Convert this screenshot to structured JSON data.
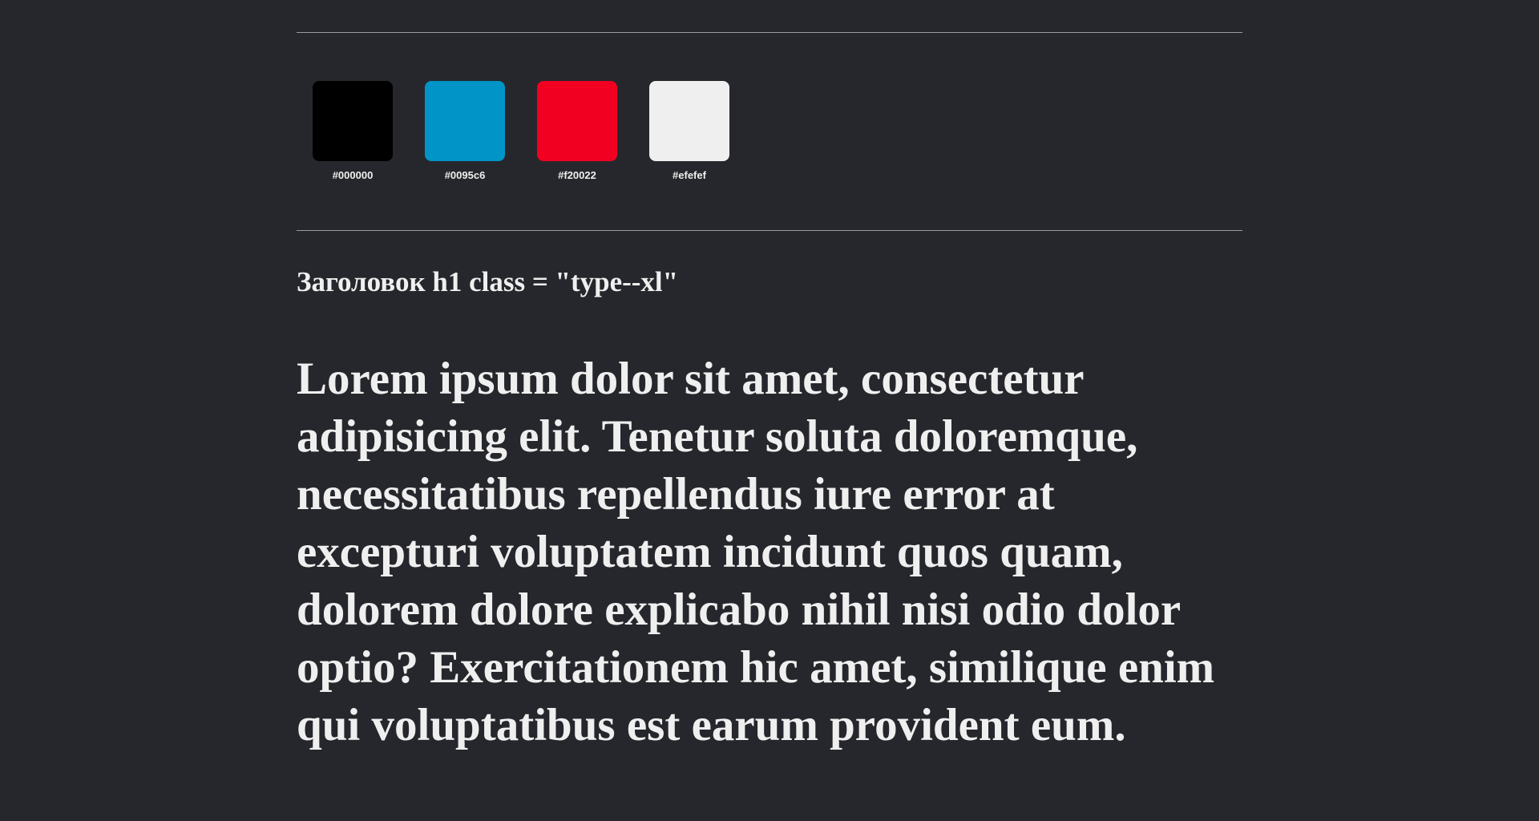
{
  "palette": {
    "swatches": [
      {
        "color": "#000000",
        "label": "#000000"
      },
      {
        "color": "#0095c6",
        "label": "#0095c6"
      },
      {
        "color": "#f20022",
        "label": "#f20022"
      },
      {
        "color": "#efefef",
        "label": "#efefef"
      }
    ]
  },
  "heading": {
    "caption": "Заголовок h1 class = \"type--xl\"",
    "sample": "Lorem ipsum dolor sit amet, consectetur adipisicing elit. Tenetur soluta doloremque, necessitatibus repellendus iure error at excepturi voluptatem incidunt quos quam, dolorem dolore explicabo nihil nisi odio dolor optio? Exercitationem hic amet, similique enim qui voluptatibus est earum provident eum."
  },
  "theme": {
    "background": "#26272c",
    "text": "#efefef"
  }
}
